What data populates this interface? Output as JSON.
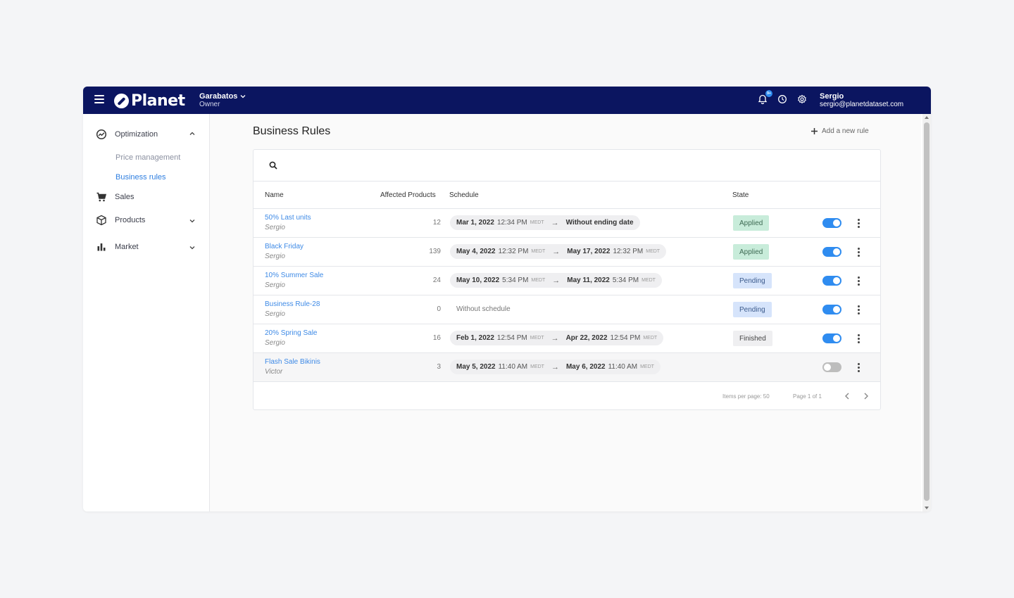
{
  "brand": {
    "name": "Planet"
  },
  "account": {
    "name": "Garabatos",
    "role": "Owner"
  },
  "topbar": {
    "notification_badge": "9+",
    "icons": [
      "bell-icon",
      "clock-icon",
      "gear-icon"
    ]
  },
  "user": {
    "name": "Sergio",
    "email": "sergio@planetdataset.com"
  },
  "sidebar": {
    "optimization": "Optimization",
    "price_management": "Price management",
    "business_rules": "Business rules",
    "sales": "Sales",
    "products": "Products",
    "market": "Market"
  },
  "page": {
    "title": "Business Rules",
    "add_rule": "Add a new rule"
  },
  "search": {
    "placeholder": ""
  },
  "table": {
    "columns": {
      "name": "Name",
      "affected": "Affected Products",
      "schedule": "Schedule",
      "state": "State"
    },
    "rows": [
      {
        "name": "50% Last units",
        "owner": "Sergio",
        "count": "12",
        "start_date": "Mar 1, 2022",
        "start_time": "12:34 PM",
        "start_tz": "MEDT",
        "end_date": "Without ending date",
        "end_time": "",
        "end_tz": "",
        "state": "Applied",
        "enabled": true
      },
      {
        "name": "Black Friday",
        "owner": "Sergio",
        "count": "139",
        "start_date": "May 4, 2022",
        "start_time": "12:32 PM",
        "start_tz": "MEDT",
        "end_date": "May 17, 2022",
        "end_time": "12:32 PM",
        "end_tz": "MEDT",
        "state": "Applied",
        "enabled": true
      },
      {
        "name": "10% Summer Sale",
        "owner": "Sergio",
        "count": "24",
        "start_date": "May 10, 2022",
        "start_time": "5:34 PM",
        "start_tz": "MEDT",
        "end_date": "May 11, 2022",
        "end_time": "5:34 PM",
        "end_tz": "MEDT",
        "state": "Pending",
        "enabled": true
      },
      {
        "name": "Business Rule-28",
        "owner": "Sergio",
        "count": "0",
        "no_schedule": "Without schedule",
        "state": "Pending",
        "enabled": true
      },
      {
        "name": "20% Spring Sale",
        "owner": "Sergio",
        "count": "16",
        "start_date": "Feb 1, 2022",
        "start_time": "12:54 PM",
        "start_tz": "MEDT",
        "end_date": "Apr 22, 2022",
        "end_time": "12:54 PM",
        "end_tz": "MEDT",
        "state": "Finished",
        "enabled": true
      },
      {
        "name": "Flash Sale Bikinis",
        "owner": "Victor",
        "count": "3",
        "start_date": "May 5, 2022",
        "start_time": "11:40 AM",
        "start_tz": "MEDT",
        "end_date": "May 6, 2022",
        "end_time": "11:40 AM",
        "end_tz": "MEDT",
        "state": "",
        "enabled": false
      }
    ]
  },
  "pager": {
    "items_per_page": "Items per page: 50",
    "page": "Page 1 of 1"
  },
  "colors": {
    "topbar": "#0b1560",
    "accent": "#2f8cf0",
    "applied_bg": "#c8ecda",
    "pending_bg": "#d6e4fb"
  }
}
